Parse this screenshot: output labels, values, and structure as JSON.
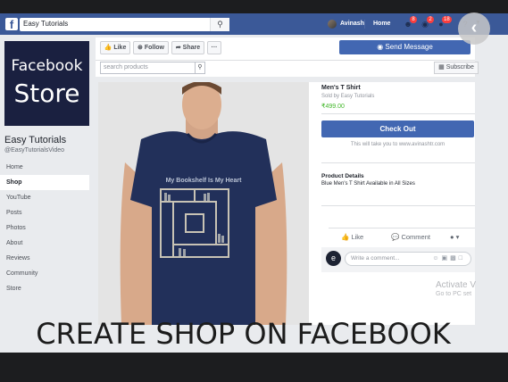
{
  "topbar": {
    "search_value": "Easy Tutorials",
    "user_name": "Avinash",
    "home_label": "Home",
    "friend_badge": "8",
    "message_badge": "2",
    "notif_badge": "18"
  },
  "sidebar": {
    "logo_line1": "Facebook",
    "logo_line2": "Store",
    "page_name": "Easy Tutorials",
    "page_handle": "@EasyTutorialsVideo",
    "items": [
      {
        "label": "Home"
      },
      {
        "label": "Shop"
      },
      {
        "label": "YouTube"
      },
      {
        "label": "Posts"
      },
      {
        "label": "Photos"
      },
      {
        "label": "About"
      },
      {
        "label": "Reviews"
      },
      {
        "label": "Community"
      },
      {
        "label": "Store"
      }
    ]
  },
  "actions": {
    "like": "Like",
    "follow": "Follow",
    "share": "Share",
    "more": "···",
    "send_message": "Send Message",
    "shop_search_placeholder": "search products",
    "subscribe": "Subscribe"
  },
  "product": {
    "title": "Men's T Shirt",
    "seller": "Sold by Easy Tutorials",
    "price": "₹499.00",
    "checkout": "Check Out",
    "note": "This will take you to www.avinashtr.com",
    "details_heading": "Product Details",
    "details_text": "Blue Men's T Shirt Available in All Sizes",
    "shirt_text": "My Bookshelf Is My Heart"
  },
  "engagement": {
    "like": "Like",
    "comment": "Comment",
    "comment_placeholder": "Write a comment..."
  },
  "watermark": {
    "line1": "Activate V",
    "line2": "Go to PC set"
  },
  "banner": "CREATE SHOP ON FACEBOOK",
  "colors": {
    "fb_blue": "#3b5998",
    "button_blue": "#4267b2",
    "price_green": "#42b72a",
    "shirt_navy": "#22305a"
  }
}
